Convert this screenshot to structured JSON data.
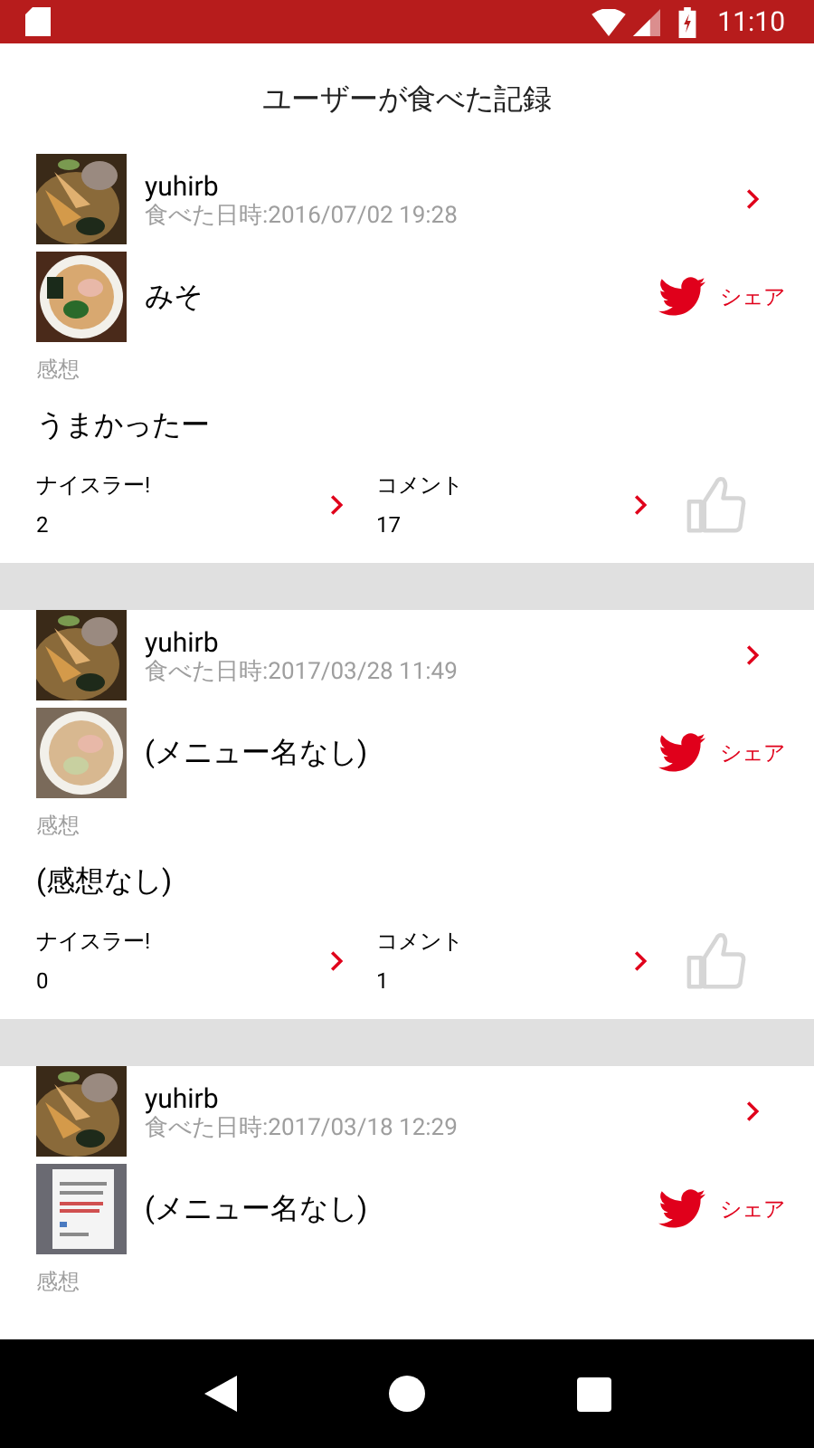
{
  "status_bar": {
    "time": "11:10"
  },
  "title": "ユーザーが食べた記録",
  "records": [
    {
      "user": "yuhirb",
      "date": "食べた日時:2016/07/02 19:28",
      "menu": "みそ",
      "share": "シェア",
      "impression_label": "感想",
      "impression": "うまかったー",
      "nice_label": "ナイスラー!",
      "nice_count": "2",
      "comment_label": "コメント",
      "comment_count": "17",
      "liked": false
    },
    {
      "user": "yuhirb",
      "date": "食べた日時:2017/03/28 11:49",
      "menu": "(メニュー名なし)",
      "share": "シェア",
      "impression_label": "感想",
      "impression": "(感想なし)",
      "nice_label": "ナイスラー!",
      "nice_count": "0",
      "comment_label": "コメント",
      "comment_count": "1",
      "liked": false
    },
    {
      "user": "yuhirb",
      "date": "食べた日時:2017/03/18 12:29",
      "menu": "(メニュー名なし)",
      "share": "シェア",
      "impression_label": "感想"
    }
  ]
}
